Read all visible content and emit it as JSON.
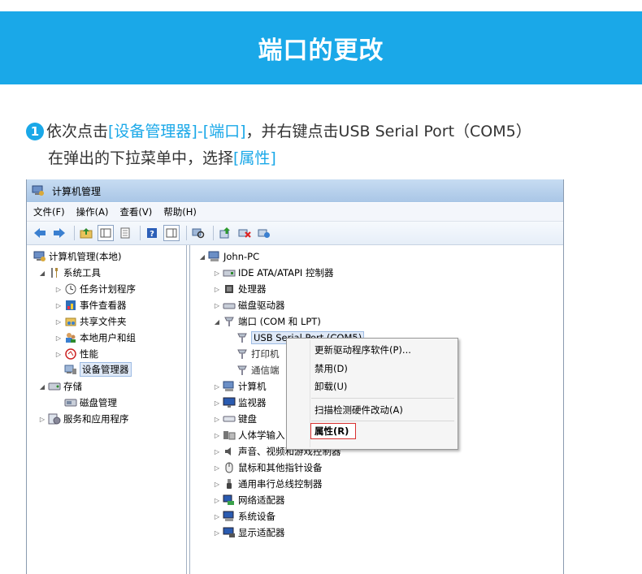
{
  "banner": {
    "title": "端口的更改"
  },
  "instruction": {
    "number": "1",
    "text1": "依次点击",
    "hl1": "[设备管理器]-[端口]",
    "text2": "，并右键点击USB Serial Port（COM5）",
    "text3": "在弹出的下拉菜单中，选择",
    "hl2": "[属性]"
  },
  "window": {
    "title": "计算机管理",
    "menu": [
      "文件(F)",
      "操作(A)",
      "查看(V)",
      "帮助(H)"
    ]
  },
  "left_tree": {
    "root": "计算机管理(本地)",
    "system_tools": "系统工具",
    "task_scheduler": "任务计划程序",
    "event_viewer": "事件查看器",
    "shared_folders": "共享文件夹",
    "local_users": "本地用户和组",
    "performance": "性能",
    "device_manager": "设备管理器",
    "storage": "存储",
    "disk_management": "磁盘管理",
    "services_apps": "服务和应用程序"
  },
  "right_tree": {
    "root": "John-PC",
    "ide": "IDE ATA/ATAPI 控制器",
    "cpu": "处理器",
    "disk": "磁盘驱动器",
    "ports": "端口 (COM 和 LPT)",
    "usb_serial": "USB Serial Port (COM5)",
    "printer_port": "打印机",
    "comm_port": "通信端",
    "computer": "计算机",
    "monitor": "监视器",
    "keyboard": "键盘",
    "hid": "人体学输入",
    "sound": "声音、视频和游戏控制器",
    "mouse": "鼠标和其他指针设备",
    "usb_ctrl": "通用串行总线控制器",
    "network": "网络适配器",
    "system_dev": "系统设备",
    "display": "显示适配器"
  },
  "context_menu": {
    "update_driver": "更新驱动程序软件(P)...",
    "disable": "禁用(D)",
    "uninstall": "卸载(U)",
    "scan": "扫描检测硬件改动(A)",
    "properties": "属性(R)"
  }
}
